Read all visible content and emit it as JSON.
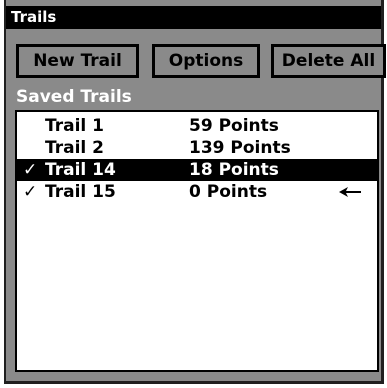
{
  "window": {
    "title": "Trails"
  },
  "toolbar": {
    "new_trail_label": "New Trail",
    "options_label": "Options",
    "delete_all_label": "Delete All"
  },
  "saved_trails": {
    "label": "Saved Trails",
    "rows": [
      {
        "checked": "",
        "name": "Trail 1",
        "points": "59 Points",
        "selected": false,
        "active_arrow": false
      },
      {
        "checked": "",
        "name": "Trail 2",
        "points": "139 Points",
        "selected": false,
        "active_arrow": false
      },
      {
        "checked": "✓",
        "name": "Trail 14",
        "points": "18 Points",
        "selected": true,
        "active_arrow": false
      },
      {
        "checked": "✓",
        "name": "Trail 15",
        "points": "0 Points",
        "selected": false,
        "active_arrow": true
      }
    ]
  },
  "icons": {
    "checkmark": "check-icon",
    "active_trail": "arrow-left-icon"
  },
  "colors": {
    "background": "#8a8a8a",
    "title_bar": "#000000",
    "list_background": "#ffffff",
    "selected_row": "#000000"
  }
}
